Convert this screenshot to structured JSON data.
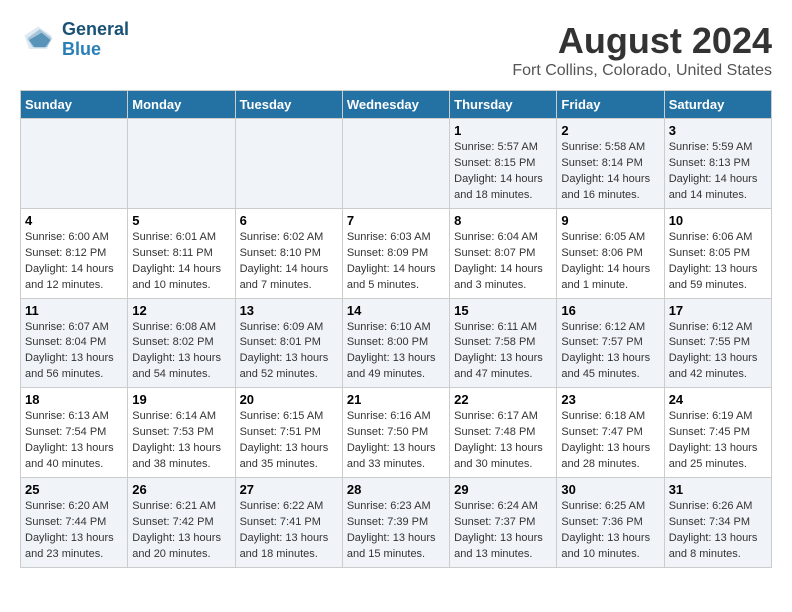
{
  "header": {
    "logo_line1": "General",
    "logo_line2": "Blue",
    "main_title": "August 2024",
    "subtitle": "Fort Collins, Colorado, United States"
  },
  "weekdays": [
    "Sunday",
    "Monday",
    "Tuesday",
    "Wednesday",
    "Thursday",
    "Friday",
    "Saturday"
  ],
  "weeks": [
    [
      {
        "day": "",
        "info": ""
      },
      {
        "day": "",
        "info": ""
      },
      {
        "day": "",
        "info": ""
      },
      {
        "day": "",
        "info": ""
      },
      {
        "day": "1",
        "info": "Sunrise: 5:57 AM\nSunset: 8:15 PM\nDaylight: 14 hours\nand 18 minutes."
      },
      {
        "day": "2",
        "info": "Sunrise: 5:58 AM\nSunset: 8:14 PM\nDaylight: 14 hours\nand 16 minutes."
      },
      {
        "day": "3",
        "info": "Sunrise: 5:59 AM\nSunset: 8:13 PM\nDaylight: 14 hours\nand 14 minutes."
      }
    ],
    [
      {
        "day": "4",
        "info": "Sunrise: 6:00 AM\nSunset: 8:12 PM\nDaylight: 14 hours\nand 12 minutes."
      },
      {
        "day": "5",
        "info": "Sunrise: 6:01 AM\nSunset: 8:11 PM\nDaylight: 14 hours\nand 10 minutes."
      },
      {
        "day": "6",
        "info": "Sunrise: 6:02 AM\nSunset: 8:10 PM\nDaylight: 14 hours\nand 7 minutes."
      },
      {
        "day": "7",
        "info": "Sunrise: 6:03 AM\nSunset: 8:09 PM\nDaylight: 14 hours\nand 5 minutes."
      },
      {
        "day": "8",
        "info": "Sunrise: 6:04 AM\nSunset: 8:07 PM\nDaylight: 14 hours\nand 3 minutes."
      },
      {
        "day": "9",
        "info": "Sunrise: 6:05 AM\nSunset: 8:06 PM\nDaylight: 14 hours\nand 1 minute."
      },
      {
        "day": "10",
        "info": "Sunrise: 6:06 AM\nSunset: 8:05 PM\nDaylight: 13 hours\nand 59 minutes."
      }
    ],
    [
      {
        "day": "11",
        "info": "Sunrise: 6:07 AM\nSunset: 8:04 PM\nDaylight: 13 hours\nand 56 minutes."
      },
      {
        "day": "12",
        "info": "Sunrise: 6:08 AM\nSunset: 8:02 PM\nDaylight: 13 hours\nand 54 minutes."
      },
      {
        "day": "13",
        "info": "Sunrise: 6:09 AM\nSunset: 8:01 PM\nDaylight: 13 hours\nand 52 minutes."
      },
      {
        "day": "14",
        "info": "Sunrise: 6:10 AM\nSunset: 8:00 PM\nDaylight: 13 hours\nand 49 minutes."
      },
      {
        "day": "15",
        "info": "Sunrise: 6:11 AM\nSunset: 7:58 PM\nDaylight: 13 hours\nand 47 minutes."
      },
      {
        "day": "16",
        "info": "Sunrise: 6:12 AM\nSunset: 7:57 PM\nDaylight: 13 hours\nand 45 minutes."
      },
      {
        "day": "17",
        "info": "Sunrise: 6:12 AM\nSunset: 7:55 PM\nDaylight: 13 hours\nand 42 minutes."
      }
    ],
    [
      {
        "day": "18",
        "info": "Sunrise: 6:13 AM\nSunset: 7:54 PM\nDaylight: 13 hours\nand 40 minutes."
      },
      {
        "day": "19",
        "info": "Sunrise: 6:14 AM\nSunset: 7:53 PM\nDaylight: 13 hours\nand 38 minutes."
      },
      {
        "day": "20",
        "info": "Sunrise: 6:15 AM\nSunset: 7:51 PM\nDaylight: 13 hours\nand 35 minutes."
      },
      {
        "day": "21",
        "info": "Sunrise: 6:16 AM\nSunset: 7:50 PM\nDaylight: 13 hours\nand 33 minutes."
      },
      {
        "day": "22",
        "info": "Sunrise: 6:17 AM\nSunset: 7:48 PM\nDaylight: 13 hours\nand 30 minutes."
      },
      {
        "day": "23",
        "info": "Sunrise: 6:18 AM\nSunset: 7:47 PM\nDaylight: 13 hours\nand 28 minutes."
      },
      {
        "day": "24",
        "info": "Sunrise: 6:19 AM\nSunset: 7:45 PM\nDaylight: 13 hours\nand 25 minutes."
      }
    ],
    [
      {
        "day": "25",
        "info": "Sunrise: 6:20 AM\nSunset: 7:44 PM\nDaylight: 13 hours\nand 23 minutes."
      },
      {
        "day": "26",
        "info": "Sunrise: 6:21 AM\nSunset: 7:42 PM\nDaylight: 13 hours\nand 20 minutes."
      },
      {
        "day": "27",
        "info": "Sunrise: 6:22 AM\nSunset: 7:41 PM\nDaylight: 13 hours\nand 18 minutes."
      },
      {
        "day": "28",
        "info": "Sunrise: 6:23 AM\nSunset: 7:39 PM\nDaylight: 13 hours\nand 15 minutes."
      },
      {
        "day": "29",
        "info": "Sunrise: 6:24 AM\nSunset: 7:37 PM\nDaylight: 13 hours\nand 13 minutes."
      },
      {
        "day": "30",
        "info": "Sunrise: 6:25 AM\nSunset: 7:36 PM\nDaylight: 13 hours\nand 10 minutes."
      },
      {
        "day": "31",
        "info": "Sunrise: 6:26 AM\nSunset: 7:34 PM\nDaylight: 13 hours\nand 8 minutes."
      }
    ]
  ]
}
